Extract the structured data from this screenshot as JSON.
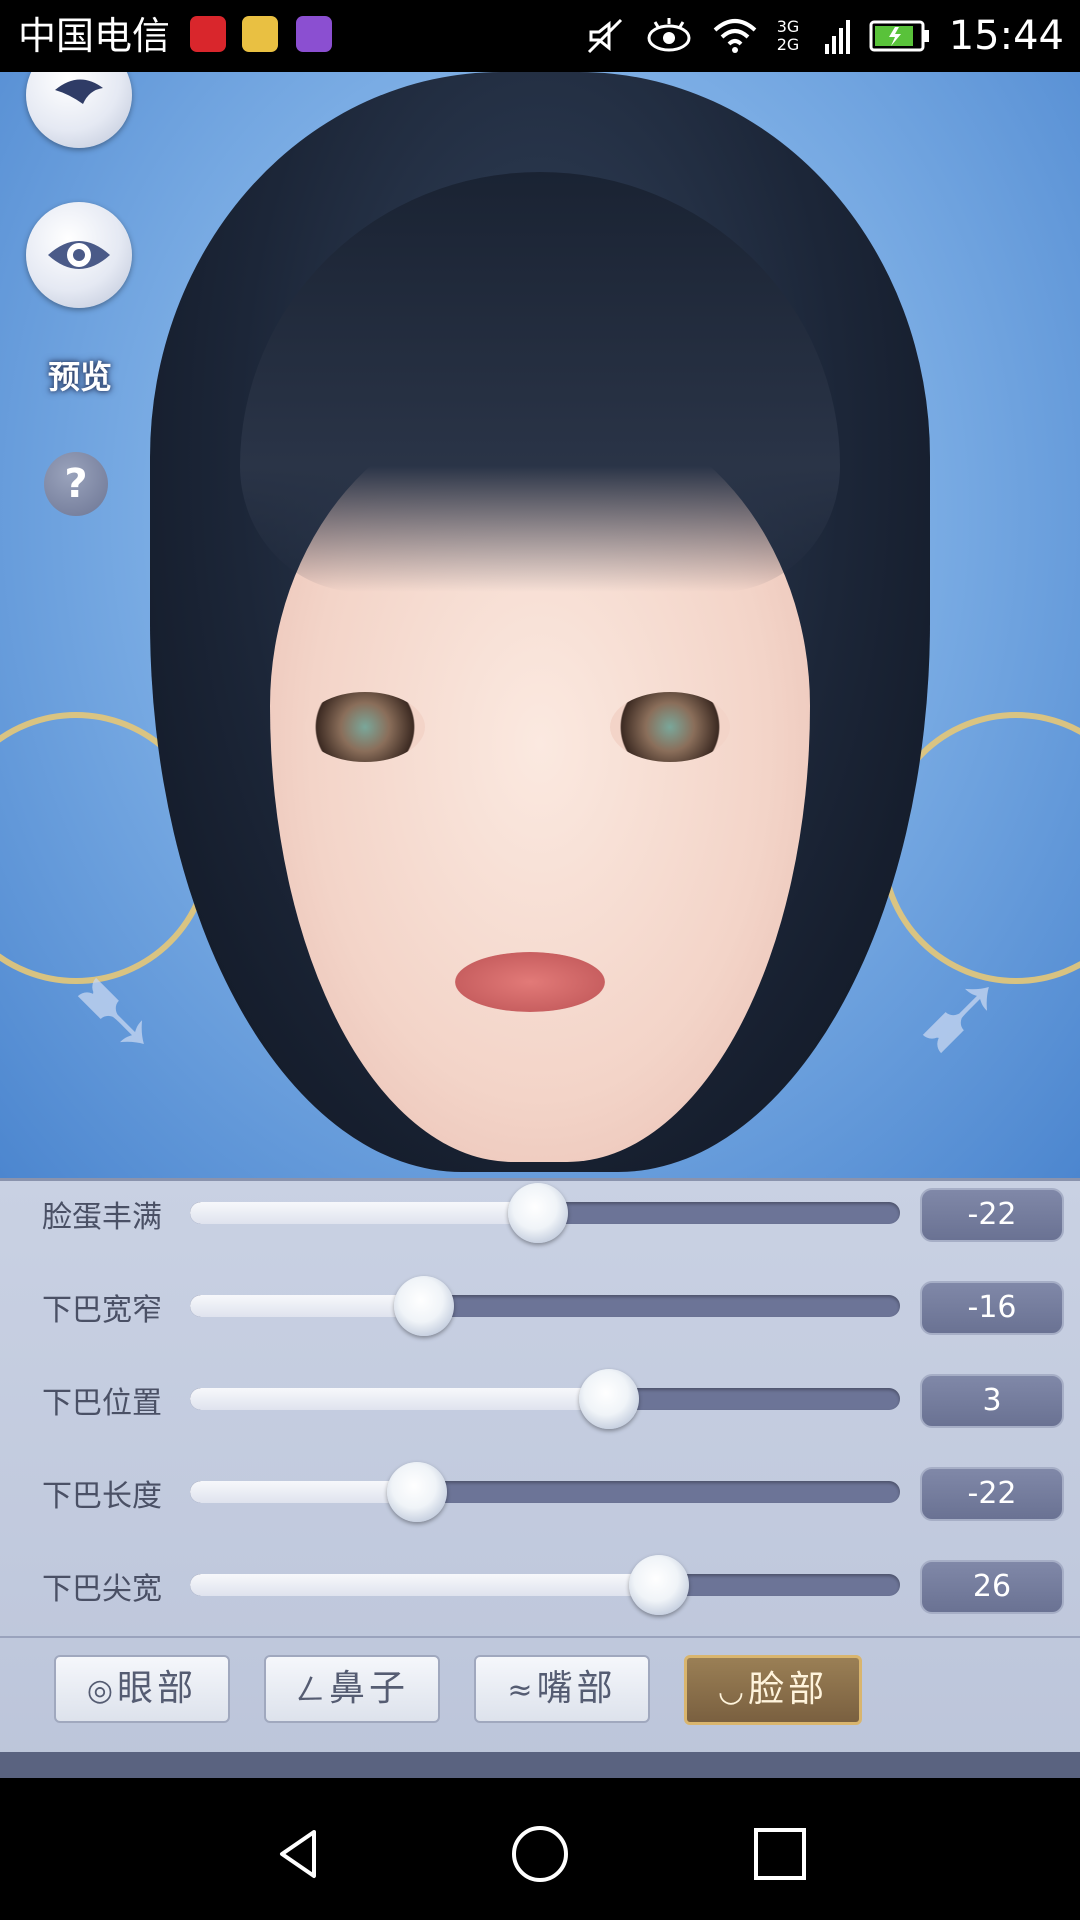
{
  "status_bar": {
    "carrier": "中国电信",
    "network": "3G 2G",
    "time": "15:44",
    "icons": [
      "netease-music-icon",
      "app-store-icon",
      "gallery-icon",
      "mute-icon",
      "eye-care-icon",
      "wifi-icon",
      "signal-icon",
      "battery-icon"
    ]
  },
  "scene": {
    "preview_label": "预览",
    "help_label": "?"
  },
  "sliders": [
    {
      "label": "脸蛋丰满",
      "value": "-22",
      "level": 0.49
    },
    {
      "label": "下巴宽窄",
      "value": "-16",
      "level": 0.33
    },
    {
      "label": "下巴位置",
      "value": "3",
      "level": 0.59
    },
    {
      "label": "下巴长度",
      "value": "-22",
      "level": 0.32
    },
    {
      "label": "下巴尖宽",
      "value": "26",
      "level": 0.66
    }
  ],
  "tabs": [
    {
      "label": "眼部",
      "icon": "eye-icon",
      "active": false
    },
    {
      "label": "鼻子",
      "icon": "nose-icon",
      "active": false
    },
    {
      "label": "嘴部",
      "icon": "mouth-icon",
      "active": false
    },
    {
      "label": "脸部",
      "icon": "face-icon",
      "active": true
    }
  ],
  "colors": {
    "accent_active_tab": "#8a6e4a",
    "track": "#6c7497",
    "panel": "#c4cce0"
  }
}
